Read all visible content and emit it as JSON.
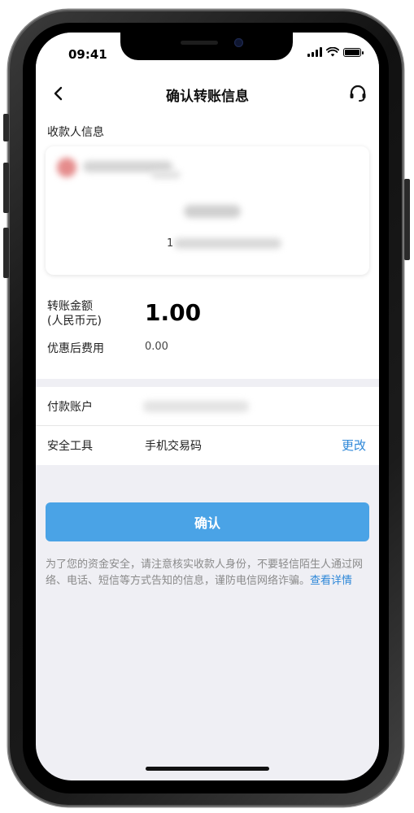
{
  "status_bar": {
    "time": "09:41"
  },
  "nav": {
    "back_icon": "chevron-left-icon",
    "title": "确认转账信息",
    "support_icon": "headset-icon"
  },
  "payee": {
    "section_label": "收款人信息",
    "account_prefix": "1"
  },
  "amount": {
    "label_line1": "转账金额",
    "label_line2": "(人民币元)",
    "value": "1.00"
  },
  "fee": {
    "label": "优惠后费用",
    "value": "0.00"
  },
  "payer": {
    "label": "付款账户"
  },
  "security": {
    "label": "安全工具",
    "value": "手机交易码",
    "change_label": "更改"
  },
  "confirm": {
    "label": "确认"
  },
  "notice": {
    "text": "为了您的资金安全，请注意核实收款人身份，不要轻信陌生人通过网络、电话、短信等方式告知的信息，谨防电信网络诈骗。",
    "link": "查看详情"
  },
  "colors": {
    "accent": "#4aa3e6",
    "link": "#2d87d8",
    "page_background": "#efeff4"
  }
}
